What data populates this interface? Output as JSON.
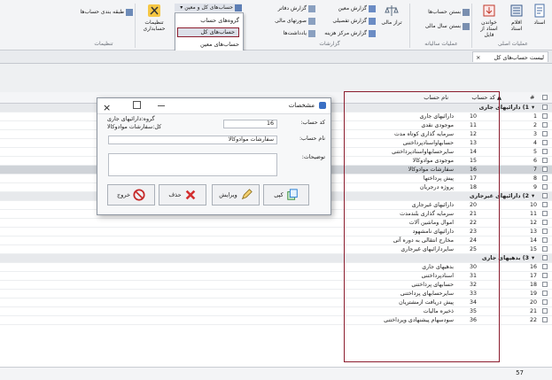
{
  "ribbon": {
    "groups": {
      "basic": "عملیات اصلی",
      "yearly": "عملیات سالیانه",
      "reports": "گزارشات",
      "settings": "تنظیمات"
    },
    "buttons": {
      "setup": "اسناد",
      "items": "اقلام اسناد",
      "read_doc": "خواندن اسناد از فایل",
      "close_accounts": "بستن حساب‌ها",
      "close_year": "بستن سال مالی",
      "balance": "تراز مالی",
      "ledger_report": "گزارش دفاتر",
      "financial_statements": "صورتهای مالی",
      "reminders": "یادداشت‌ها",
      "detail_report": "گزارش معین",
      "sub_report": "گزارش تفصیلی",
      "cost_center": "گزارش مرکز هزینه",
      "accounts_menu": "حساب‌های کل و معین",
      "account_settings": "تنظیمات حسابداری",
      "classify": "طبقه بندی حساب‌ها"
    }
  },
  "dropdown": {
    "items": [
      "گروه‌های حساب",
      "حساب‌های کل",
      "حساب‌های معین"
    ]
  },
  "tab": {
    "label": "لیست حساب‌های کل",
    "close": "×"
  },
  "grid": {
    "headers": {
      "num": "#",
      "code": "کد حساب",
      "name": "نام حساب"
    },
    "groups": [
      {
        "label": "1) دارائیهای جاری",
        "rows": [
          {
            "n": "1",
            "code": "10",
            "name": "دارائیهای جاری"
          },
          {
            "n": "2",
            "code": "11",
            "name": "موجودی نقدی"
          },
          {
            "n": "3",
            "code": "12",
            "name": "سرمایه گذاری کوتاه مدت"
          },
          {
            "n": "4",
            "code": "13",
            "name": "حسابهاواسنادپرداختنی"
          },
          {
            "n": "5",
            "code": "14",
            "name": "سایرحسابهاواسنادپرداختنی"
          },
          {
            "n": "6",
            "code": "15",
            "name": "موجودی موادوکالا"
          },
          {
            "n": "7",
            "code": "16",
            "name": "سفارشات موادوکالا"
          },
          {
            "n": "8",
            "code": "17",
            "name": "پیش پرداختها"
          },
          {
            "n": "9",
            "code": "18",
            "name": "پروژه درجریان"
          }
        ]
      },
      {
        "label": "2) دارائیهای غیرجاری",
        "rows": [
          {
            "n": "10",
            "code": "20",
            "name": "دارائیهای غیرجاری"
          },
          {
            "n": "11",
            "code": "21",
            "name": "سرمایه گذاری بلندمدت"
          },
          {
            "n": "12",
            "code": "22",
            "name": "اموال وماشین آلات"
          },
          {
            "n": "13",
            "code": "23",
            "name": "دارائیهای نامشهود"
          },
          {
            "n": "14",
            "code": "24",
            "name": "مخارج انتقالی به دوره آتی"
          },
          {
            "n": "15",
            "code": "25",
            "name": "سایردارائیهای غیرجاری"
          }
        ]
      },
      {
        "label": "3) بدهیهای جاری",
        "rows": [
          {
            "n": "16",
            "code": "30",
            "name": "بدهیهای جاری"
          },
          {
            "n": "17",
            "code": "31",
            "name": "اسنادپرداختنی"
          },
          {
            "n": "18",
            "code": "32",
            "name": "حسابهای پرداختنی"
          },
          {
            "n": "19",
            "code": "33",
            "name": "سایرحسابهای پرداختنی"
          },
          {
            "n": "20",
            "code": "34",
            "name": "پیش دریافت ازمشتریان"
          },
          {
            "n": "21",
            "code": "35",
            "name": "ذخیره مالیات"
          },
          {
            "n": "22",
            "code": "36",
            "name": "سودسهام پیشنهادی وپرداختنی"
          }
        ]
      }
    ],
    "footer_count": "57"
  },
  "dialog": {
    "title": "مشخصات",
    "code_label": "کد حساب:",
    "code_value": "16",
    "group_label": "گروه:",
    "group_value": "دارائیهای جاری",
    "kol_label": "کل:",
    "kol_value": "سفارشات موادوکالا",
    "name_label": "نام حساب:",
    "name_value": "سفارشات موادوکالا",
    "desc_label": "توضیحات:",
    "buttons": {
      "copy": "کپی",
      "edit": "ویرایش",
      "delete": "حذف",
      "exit": "خروج"
    }
  },
  "colors": {
    "accent_box": "#8c1d2e",
    "dropdown_highlight": "#dcdfe8"
  }
}
